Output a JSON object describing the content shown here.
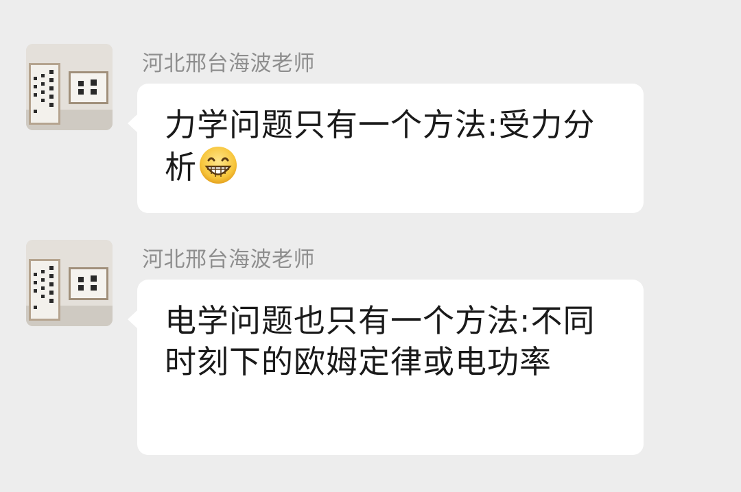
{
  "messages": [
    {
      "sender": "河北邢台海波老师",
      "text": "力学问题只有一个方法:受力分析",
      "emoji": "grinning-face-icon"
    },
    {
      "sender": "河北邢台海波老师",
      "text": "电学问题也只有一个方法:不同时刻下的欧姆定律或电功率"
    }
  ],
  "colors": {
    "background": "#ededed",
    "bubble": "#ffffff",
    "sender_name": "#8e8e8e",
    "message_text": "#1a1a1a"
  }
}
